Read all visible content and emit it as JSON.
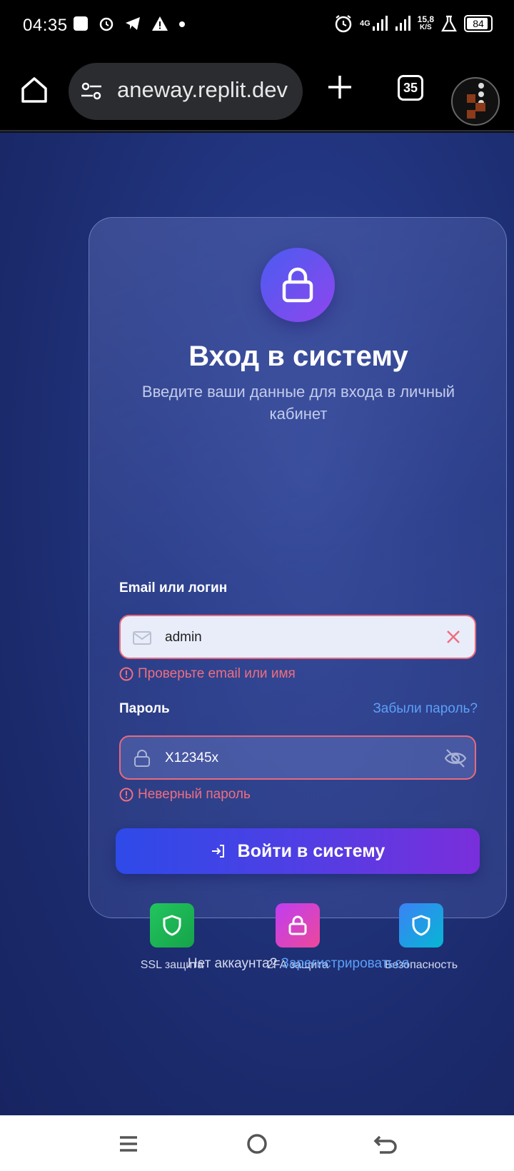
{
  "status_bar": {
    "time": "04:35",
    "network": "4G",
    "speed": "15,8",
    "speed_unit": "K/S",
    "battery": "84"
  },
  "browser": {
    "url": "aneway.replit.dev",
    "tab_count": "35"
  },
  "login": {
    "title": "Вход в систему",
    "subtitle": "Введите ваши данные для входа в личный кабинет",
    "email_label": "Email или логин",
    "email_value": "admin",
    "email_error": "Проверьте email или имя",
    "password_label": "Пароль",
    "forgot_link": "Забыли пароль?",
    "password_value": "X12345x",
    "password_error": "Неверный пароль",
    "submit_label": "Войти в систему",
    "features": [
      {
        "label": "SSL защита",
        "icon": "shield-icon",
        "color": "#22c55e"
      },
      {
        "label": "2FA защита",
        "icon": "lock-icon",
        "color": "#d946ef"
      },
      {
        "label": "Безопасность",
        "icon": "shield-icon",
        "color": "#3b82f6"
      }
    ],
    "register_prompt": "Нет аккаунта?",
    "register_link": "Зарегистрироваться"
  },
  "colors": {
    "accent": "#5ca0f7",
    "error": "#ef6e7f",
    "button_start": "#2e4ae8",
    "button_end": "#7a2edb"
  }
}
